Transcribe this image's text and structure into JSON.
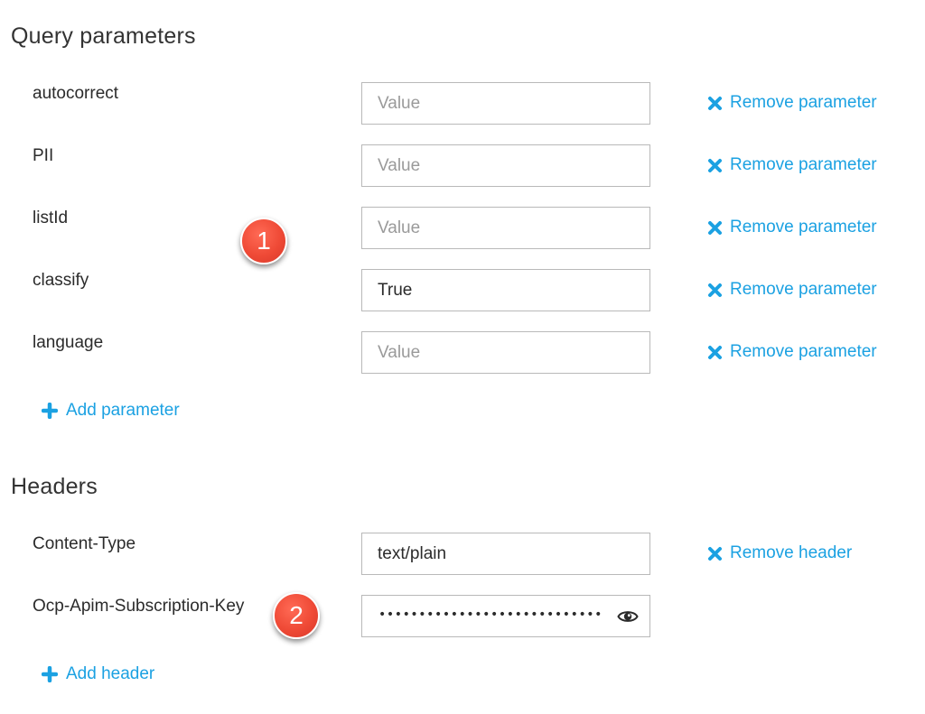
{
  "query_section": {
    "title": "Query parameters",
    "params": [
      {
        "name": "autocorrect",
        "value": "",
        "placeholder": "Value"
      },
      {
        "name": "PII",
        "value": "",
        "placeholder": "Value"
      },
      {
        "name": "listId",
        "value": "",
        "placeholder": "Value"
      },
      {
        "name": "classify",
        "value": "True",
        "placeholder": "Value"
      },
      {
        "name": "language",
        "value": "",
        "placeholder": "Value"
      }
    ],
    "remove_label": "Remove parameter",
    "add_label": "Add parameter"
  },
  "headers_section": {
    "title": "Headers",
    "headers": [
      {
        "name": "Content-Type",
        "value": "text/plain"
      },
      {
        "name": "Ocp-Apim-Subscription-Key",
        "masked_value": "•••••••••••••••••••••••••••••••••"
      }
    ],
    "remove_label": "Remove header",
    "add_label": "Add header"
  },
  "callouts": [
    "1",
    "2"
  ],
  "icons": {
    "remove": "close-x-icon",
    "add": "plus-icon",
    "reveal": "eye-icon"
  },
  "colors": {
    "link": "#1ba1e2",
    "callout": "#ef4a36",
    "input_border": "#b9b9b9"
  }
}
